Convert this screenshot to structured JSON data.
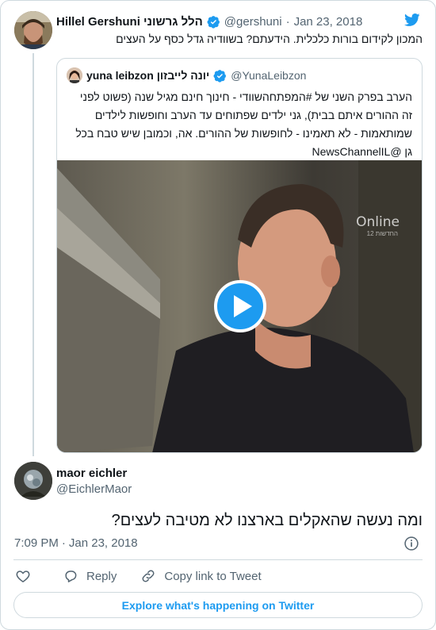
{
  "colors": {
    "accent": "#1d9bf0",
    "secondary_text": "#536471",
    "border": "#cfd9de",
    "verified": "#1d9bf0"
  },
  "parent_tweet": {
    "display_name": "Hillel Gershuni הלל גרשוני",
    "handle": "@gershuni",
    "separator": "·",
    "date": "Jan 23, 2018",
    "text": "המכון לקידום בורות כלכלית. הידעתם? בשוודיה גדל כסף על העצים"
  },
  "quoted_tweet": {
    "display_name": "yuna leibzon יונה לייבזון",
    "handle": "@YunaLeibzon",
    "text": "הערב בפרק השני של #המפתחהשוודי - חינוך חינם מגיל שנה (פשוט לפני זה ההורים איתם בבית), גני ילדים שפתוחים עד הערב וחופשות לילדים שמותאמות - לא תאמינו - לחופשות של ההורים. אה, וכמובן שיש טבח בכל גן @NewsChannelIL",
    "media": {
      "watermark": "Online",
      "watermark_sub": "החדשות 12",
      "play_icon": "play-icon"
    }
  },
  "reply_tweet": {
    "display_name": "maor eichler",
    "handle": "@EichlerMaor",
    "text": "ומה נעשה שהאקלים בארצנו לא מטיבה לעצים?",
    "time": "7:09 PM",
    "separator": "·",
    "date": "Jan 23, 2018"
  },
  "actions": {
    "like_label": "",
    "reply_label": "Reply",
    "copy_label": "Copy link to Tweet"
  },
  "explore_label": "Explore what's happening on Twitter",
  "icons": [
    "twitter-bird-icon",
    "verified-badge-icon",
    "play-icon",
    "info-icon",
    "heart-icon",
    "reply-bubble-icon",
    "link-icon"
  ]
}
